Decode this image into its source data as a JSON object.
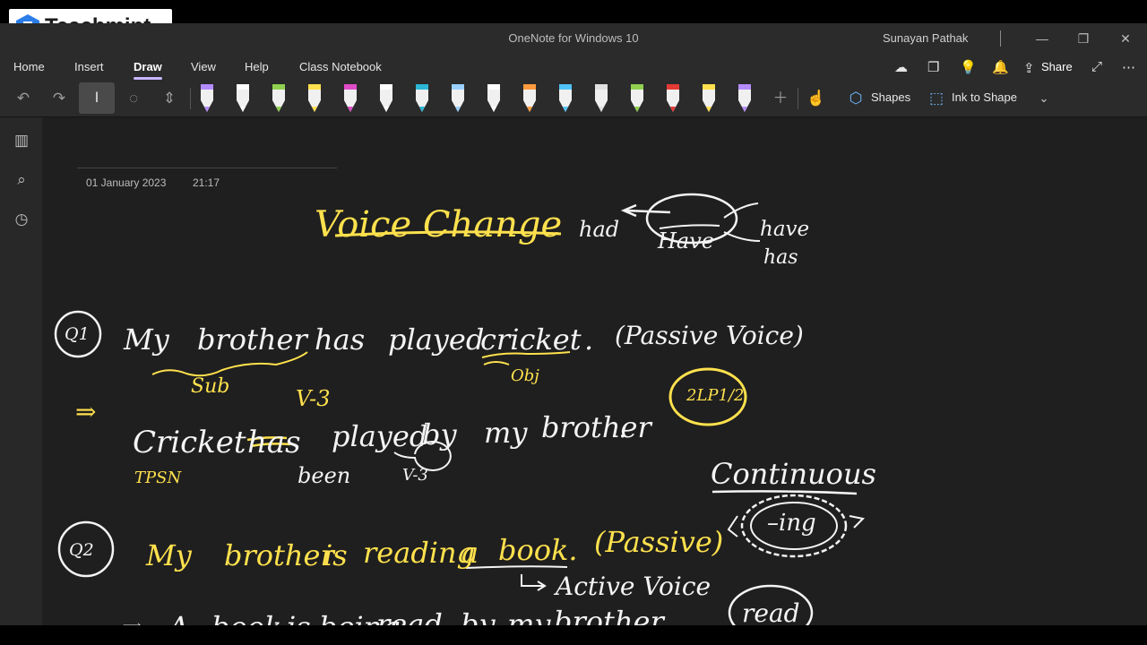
{
  "watermark": {
    "brand": "Teachmint"
  },
  "window": {
    "title": "OneNote for Windows 10",
    "user": "Sunayan Pathak",
    "minimize": "—",
    "restore": "❐",
    "close": "✕"
  },
  "menu": {
    "tabs": [
      "Home",
      "Insert",
      "Draw",
      "View",
      "Help",
      "Class Notebook"
    ],
    "active_tab": "Draw",
    "share_label": "Share"
  },
  "toolbar": {
    "pens": [
      {
        "color": "#b38cff"
      },
      {
        "color": "#ffffff"
      },
      {
        "color": "#8fd14f"
      },
      {
        "color": "#ffe14d"
      },
      {
        "color": "#e04bc8"
      },
      {
        "color": "#ffffff"
      },
      {
        "color": "#2bb6d6"
      },
      {
        "color": "#9ad0ff"
      },
      {
        "color": "#ffffff"
      },
      {
        "color": "#ff9a3c"
      },
      {
        "color": "#4fc3f7"
      },
      {
        "color": "#e0e0e0"
      },
      {
        "color": "#8fd14f"
      },
      {
        "color": "#e53935"
      },
      {
        "color": "#ffe14d"
      },
      {
        "color": "#b38cff"
      }
    ],
    "shapes_label": "Shapes",
    "ink_to_shape_label": "Ink to Shape"
  },
  "page": {
    "date": "01 January 2023",
    "time": "21:17"
  },
  "notes": {
    "title": "Voice Change",
    "have_had": "had",
    "have": "Have",
    "have_forms": [
      "have",
      "has"
    ],
    "q1": "Q1",
    "q1_sentence": [
      "My",
      "brother",
      "has",
      "played",
      "cricket",
      "."
    ],
    "q1_voice": "(Passive Voice)",
    "label_sub": "Sub",
    "label_obj": "Obj",
    "arrow": "⇒",
    "v3_top": "V-3",
    "ans1": [
      "Cricket",
      "has",
      "played",
      "by",
      "my",
      "brother",
      "."
    ],
    "tpsn": "TPSN",
    "been": "been",
    "v3_circled": "V-3",
    "circle_yellow": "2LP1/2",
    "continuous": "Continuous",
    "ing": "–ing",
    "q2": "Q2",
    "q2_sentence": [
      "My",
      "brother",
      "is",
      "reading",
      "a",
      "book."
    ],
    "q2_voice": "(Passive)",
    "active_voice": "Active Voice",
    "ans2": [
      "A",
      "book",
      "is",
      "being",
      "read",
      "by",
      "my",
      "brother"
    ],
    "read": "read"
  }
}
